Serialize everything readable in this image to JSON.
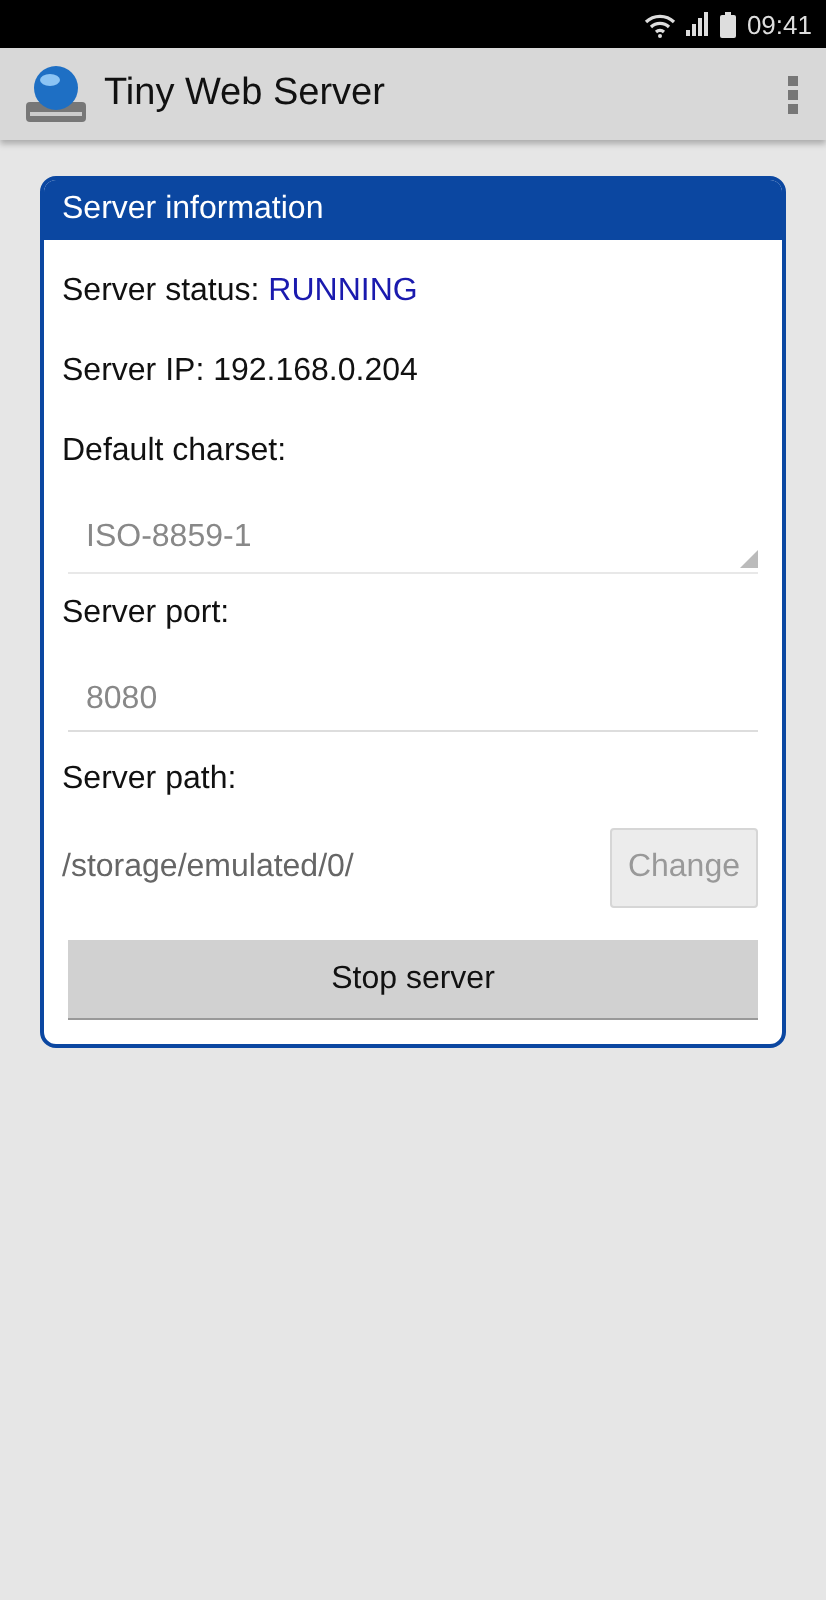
{
  "status_bar": {
    "time": "09:41"
  },
  "app_bar": {
    "title": "Tiny Web Server"
  },
  "card": {
    "title": "Server information",
    "status": {
      "label": "Server status:",
      "value": "RUNNING"
    },
    "ip": {
      "label": "Server IP:",
      "value": "192.168.0.204"
    },
    "charset": {
      "label": "Default charset:",
      "value": "ISO-8859-1",
      "disabled": true
    },
    "port": {
      "label": "Server port:",
      "value": "8080",
      "disabled": true
    },
    "path": {
      "label": "Server path:",
      "value": "/storage/emulated/0/",
      "button": "Change",
      "button_disabled": true
    },
    "action_button": "Stop server"
  }
}
